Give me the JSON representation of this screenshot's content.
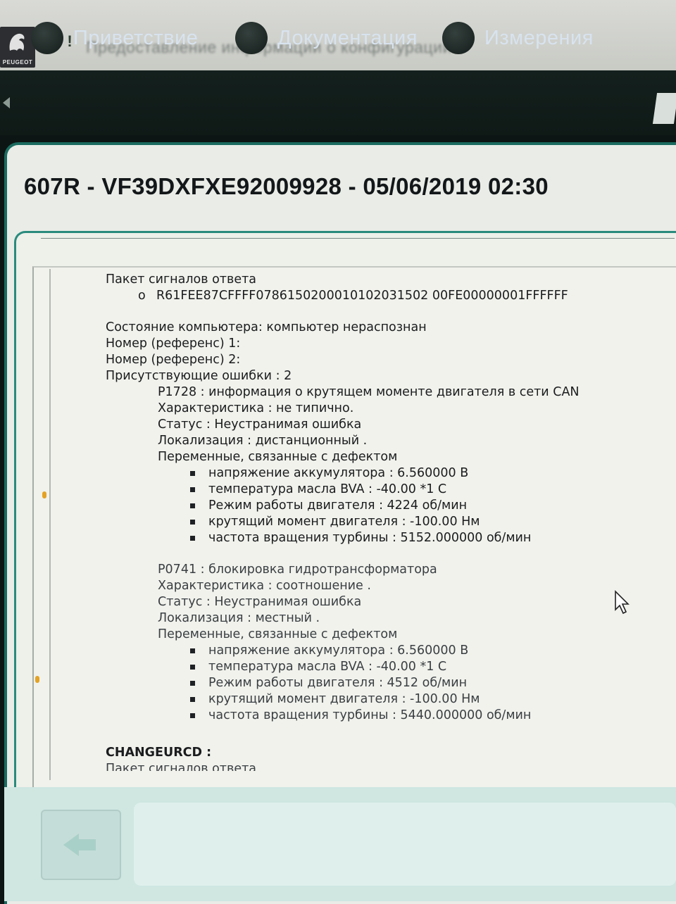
{
  "brand": {
    "logo_text": "PEUGEOT"
  },
  "titlebar": {
    "alert_symbol": "!",
    "blurred_title": "Предоставление информации о конфигурации"
  },
  "tabs": [
    {
      "label": "Приветствие",
      "icon": "circle-icon"
    },
    {
      "label": "Документация",
      "icon": "circle-icon"
    },
    {
      "label": "Измерения",
      "icon": "circle-icon"
    }
  ],
  "header": {
    "title": "607R - VF39DXFXE92009928 - 05/06/2019 02:30"
  },
  "report": {
    "response_packet_label": "Пакет сигналов ответа",
    "response_packet_bullet": "o",
    "response_packet_value": "R61FEE87CFFFF0786150200010102031502 00FE00000001FFFFFF",
    "computer_state": "Состояние компьютера: компьютер нераспознан",
    "ref1": "Номер (референс) 1:",
    "ref2": "Номер (референс) 2:",
    "present_faults": "Присутствующие ошибки : 2",
    "faults": [
      {
        "code_line": "P1728 : информация о крутящем моменте двигателя в сети CAN",
        "characteristic": "Характеристика : не типично.",
        "status": "Статус : Неустранимая ошибка",
        "localization": "Локализация : дистанционный .",
        "variables_label": "Переменные, связанные с дефектом",
        "variables": [
          "напряжение аккумулятора : 6.560000 В",
          "температура масла BVA : -40.00 *1 C",
          "Режим работы двигателя : 4224 об/мин",
          "крутящий момент двигателя : -100.00 Нм",
          "частота вращения турбины : 5152.000000 об/мин"
        ]
      },
      {
        "code_line": "P0741 : блокировка гидротрансформатора",
        "characteristic": "Характеристика : соотношение .",
        "status": "Статус : Неустранимая ошибка",
        "localization": "Локализация : местный .",
        "variables_label": "Переменные, связанные с дефектом",
        "variables": [
          "напряжение аккумулятора : 6.560000 В",
          "температура масла BVA : -40.00 *1 C",
          "Режим работы двигателя : 4512 об/мин",
          "крутящий момент двигателя : -100.00 Нм",
          "частота вращения турбины : 5440.000000 об/мин"
        ]
      }
    ],
    "changeurcd_label": "CHANGEURCD :",
    "changeurcd_packet": "Пакет сигналов ответа"
  },
  "colors": {
    "accent_teal": "#1b6b60",
    "tab_text": "#d8e3ef",
    "panel_bg": "#e9ece7",
    "bottom_strip": "#cfe6e1"
  }
}
